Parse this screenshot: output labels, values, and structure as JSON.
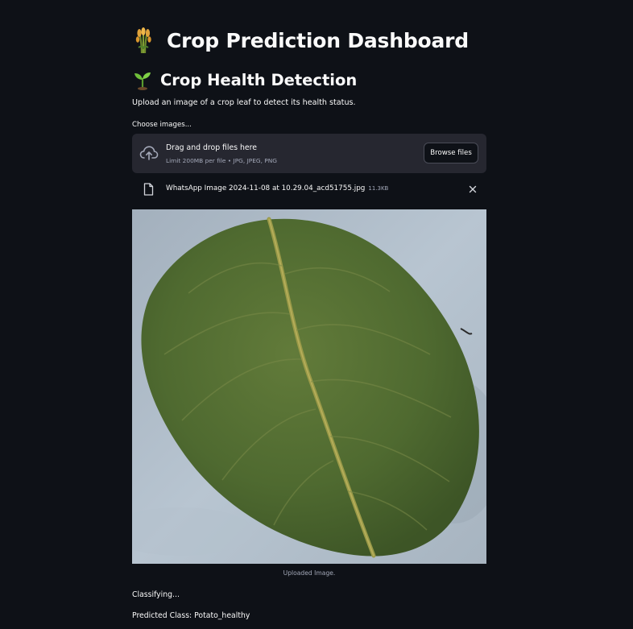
{
  "header": {
    "title": "Crop Prediction Dashboard",
    "title_icon": "sheaf-of-rice-emoji"
  },
  "section": {
    "title": "Crop Health Detection",
    "title_icon": "seedling-emoji",
    "description": "Upload an image of a crop leaf to detect its health status."
  },
  "uploader": {
    "label": "Choose images...",
    "drop_text": "Drag and drop files here",
    "limit_text": "Limit 200MB per file • JPG, JPEG, PNG",
    "browse_label": "Browse files",
    "icon": "cloud-upload-icon"
  },
  "file": {
    "name": "WhatsApp Image 2024-11-08 at 10.29.04_acd51755.jpg",
    "size": "11.3KB",
    "icon": "file-icon",
    "remove_icon": "close-icon"
  },
  "image": {
    "caption": "Uploaded Image.",
    "subject": "leaf"
  },
  "status": {
    "classifying": "Classifying...",
    "predicted": "Predicted Class: Potato_healthy"
  },
  "colors": {
    "background": "#0e1117",
    "surface": "#262730",
    "text": "#fafafa",
    "muted": "#a3a8b8"
  }
}
